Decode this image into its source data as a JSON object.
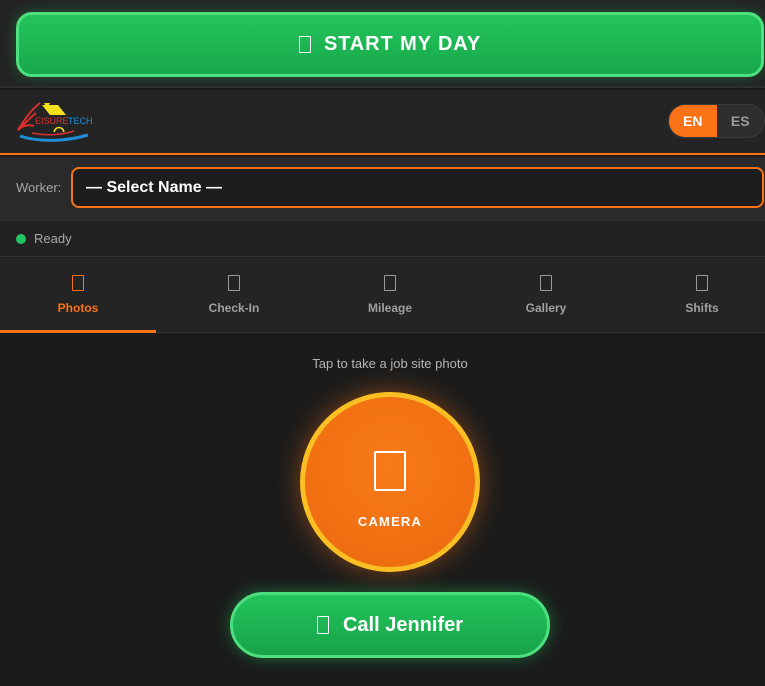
{
  "start_button": {
    "label": "START MY DAY",
    "icon": "sun-icon"
  },
  "header": {
    "logo": {
      "text_leisure": "EISURE",
      "text_tech": "TECH"
    },
    "languages": [
      {
        "code": "EN",
        "active": true
      },
      {
        "code": "ES",
        "active": false
      }
    ]
  },
  "worker": {
    "label": "Worker:",
    "selected": "— Select Name —"
  },
  "status": {
    "text": "Ready",
    "color": "#22c55e"
  },
  "tabs": [
    {
      "label": "Photos",
      "icon": "camera-icon",
      "active": true
    },
    {
      "label": "Check-In",
      "icon": "pin-icon",
      "active": false
    },
    {
      "label": "Mileage",
      "icon": "car-icon",
      "active": false
    },
    {
      "label": "Gallery",
      "icon": "images-icon",
      "active": false
    },
    {
      "label": "Shifts",
      "icon": "clock-icon",
      "active": false
    }
  ],
  "main": {
    "hint": "Tap to take a job site photo",
    "camera_label": "CAMERA",
    "call_label": "Call Jennifer"
  },
  "colors": {
    "accent": "#f97316",
    "success": "#22c55e",
    "ring": "#fbbf24",
    "background": "#1b1b1b"
  }
}
